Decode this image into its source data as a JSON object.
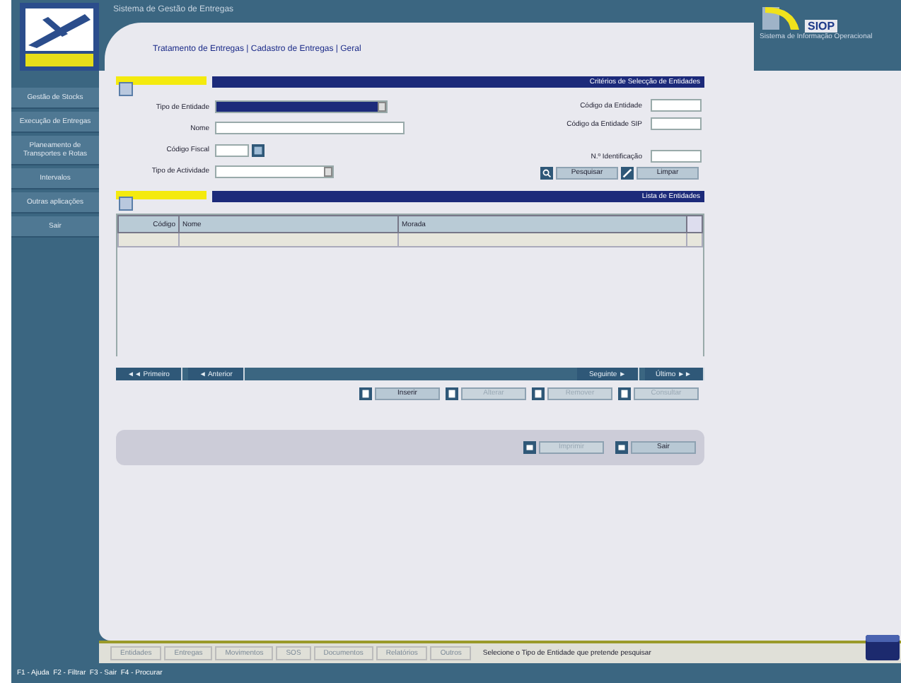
{
  "window": {
    "title": "Sistema de Gestão de Entregas"
  },
  "breadcrumb": "Tratamento de Entregas | Cadastro de Entregas | Geral",
  "brand": {
    "name": "SIOP",
    "subtitle": "Sistema de Informação Operacional"
  },
  "sidebar": {
    "items": [
      "Gestão de Stocks",
      "Execução de Entregas",
      "Planeamento de Transportes e Rotas",
      "Intervalos",
      "Outras aplicações",
      "Sair"
    ]
  },
  "search": {
    "title": "Critérios de Selecção de Entidades",
    "fields": [
      {
        "label": "Tipo de Entidade",
        "kind": "select",
        "highlighted": true
      },
      {
        "label": "Nome",
        "kind": "text",
        "highlighted": false
      },
      {
        "label": "Código Fiscal",
        "kind": "lookup",
        "highlighted": false
      },
      {
        "label": "Tipo de Actividade",
        "kind": "select",
        "highlighted": false
      }
    ],
    "side_fields": [
      {
        "label": "Código da Entidade"
      },
      {
        "label": "Código da Entidade SIP"
      },
      {
        "label": "N.º Identificação"
      }
    ],
    "buttons": [
      {
        "label": "Pesquisar",
        "kind": "search"
      },
      {
        "label": "Limpar",
        "kind": "clear"
      }
    ]
  },
  "results": {
    "title": "Lista de Entidades",
    "columns": [
      "Código",
      "Nome",
      "Morada"
    ],
    "rows": [
      {
        "selected": true
      }
    ]
  },
  "pager": [
    "◄◄ Primeiro",
    "◄ Anterior",
    "Seguinte ►",
    "Último ►►"
  ],
  "actions": [
    {
      "label": "Inserir",
      "disabled": false
    },
    {
      "label": "Alterar",
      "disabled": true
    },
    {
      "label": "Remover",
      "disabled": true
    },
    {
      "label": "Consultar",
      "disabled": true
    }
  ],
  "footer_buttons": [
    {
      "label": "Imprimir",
      "disabled": true
    },
    {
      "label": "Sair",
      "disabled": false
    }
  ],
  "status_bar": {
    "tabs": [
      "Entidades",
      "Entregas",
      "Movimentos",
      "SOS",
      "Documentos",
      "Relatórios",
      "Outros"
    ],
    "message": "Selecione o Tipo de Entidade que pretende pesquisar"
  },
  "shortcuts": "F1 - Ajuda  F2 - Filtrar  F3 - Sair  F4 - Procurar"
}
